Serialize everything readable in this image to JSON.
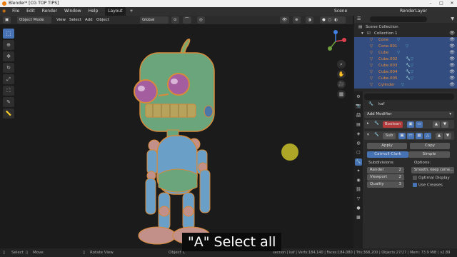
{
  "window": {
    "title": "Blender* [CG TOP TIPS]"
  },
  "menu": {
    "items": [
      "File",
      "Edit",
      "Render",
      "Window",
      "Help"
    ],
    "workspace_tab": "Layout",
    "add_tab": "+",
    "scene": "Scene",
    "view_layer": "RenderLayer"
  },
  "header": {
    "mode": "Object Mode",
    "view": "View",
    "select": "Select",
    "add": "Add",
    "object": "Object",
    "orientation": "Global"
  },
  "outliner": {
    "title": "Scene Collection",
    "collection": "Collection 1",
    "items": [
      "Cone",
      "Cone.001",
      "Cube",
      "Cube.002",
      "Cube.003",
      "Cube.004",
      "Cube.005",
      "Cylinder"
    ]
  },
  "properties": {
    "object_name": "kaf",
    "add_modifier": "Add Modifier",
    "modifier1": "Boolean",
    "modifier2": "Sub",
    "apply": "Apply",
    "copy": "Copy",
    "catmull": "Catmull-Clark",
    "simple": "Simple",
    "subdivisions": "Subdivisions:",
    "options": "Options:",
    "render_label": "Render",
    "render_val": "2",
    "viewport_label": "Viewport",
    "viewport_val": "2",
    "quality_label": "Quality",
    "quality_val": "3",
    "uv_smooth": "Smooth, keep corne...",
    "optimal_display": "Optimal Display",
    "use_creases": "Use Creases"
  },
  "status": {
    "select": "Select",
    "move": "Move",
    "rotate": "Rotate View",
    "object": "Object C",
    "stats": "llection | kaf | Verts:184,140 | Faces:184,080 | Tris:368,200 | Objects:27/27 | Mem: 73.9 MiB | v2.89"
  },
  "subtitle": "\"A\" Select all",
  "colors": {
    "accent": "#4772b3",
    "selected_row": "#334d80",
    "object_orange": "#e88d3a",
    "robot_green": "#6aa57c"
  }
}
